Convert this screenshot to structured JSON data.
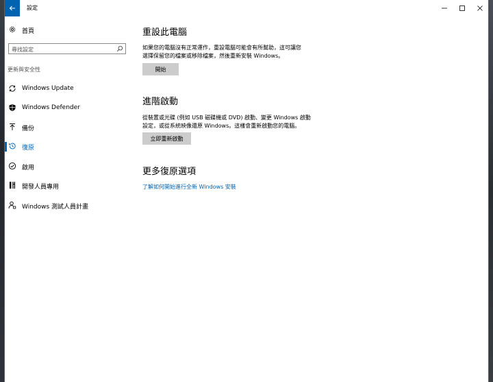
{
  "window": {
    "title": "設定",
    "controls": {
      "minimize": "—",
      "maximize": "☐",
      "close": "✕"
    }
  },
  "sidebar": {
    "home_label": "首頁",
    "search_placeholder": "尋找設定",
    "section_label": "更新與安全性",
    "items": [
      {
        "label": "Windows Update",
        "icon": "sync-icon"
      },
      {
        "label": "Windows Defender",
        "icon": "shield-icon"
      },
      {
        "label": "備份",
        "icon": "backup-arrow-icon"
      },
      {
        "label": "復原",
        "icon": "history-icon",
        "selected": true
      },
      {
        "label": "啟用",
        "icon": "checkmark-circle-icon"
      },
      {
        "label": "開發人員專用",
        "icon": "developer-tools-icon"
      },
      {
        "label": "Windows 測試人員計畫",
        "icon": "person-insider-icon"
      }
    ]
  },
  "main": {
    "reset": {
      "title": "重設此電腦",
      "description_line1": "如果您的電腦沒有正常運作，重設電腦可能會有所幫助，這可讓您",
      "description_line2": "選擇保留您的檔案或移除檔案，然後重新安裝 Windows。",
      "button": "開始"
    },
    "advanced": {
      "title": "進階啟動",
      "description_line1": "從裝置或光碟 (例如 USB 磁碟機或 DVD) 啟動、變更 Windows 啟動",
      "description_line2": "設定，或從系統映像還原 Windows。這樣會重新啟動您的電腦。",
      "button": "立即重新啟動"
    },
    "more": {
      "title": "更多復原選項",
      "link": "了解如何開始進行全新 Windows 安裝"
    }
  },
  "colors": {
    "accent": "#0063b1",
    "button_bg": "#cccccc",
    "window_bg": "#ffffff"
  }
}
